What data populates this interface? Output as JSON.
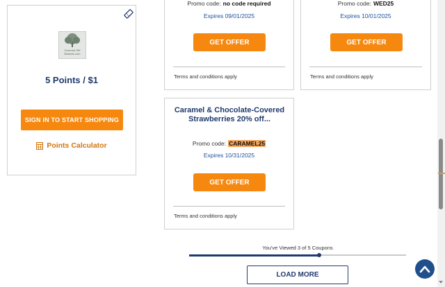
{
  "store": {
    "logo_text": "Gourmet Gift Baskets.com",
    "points_label": "5 Points / $1",
    "signin_label": "SIGN IN TO START SHOPPING",
    "calculator_label": "Points Calculator"
  },
  "coupons": [
    {
      "promo_label": "Promo code:",
      "code": "no code required",
      "expires": "Expires 09/01/2025",
      "button": "GET OFFER",
      "terms": "Terms and conditions apply"
    },
    {
      "promo_label": "Promo code:",
      "code": "WED25",
      "expires": "Expires 10/01/2025",
      "button": "GET OFFER",
      "terms": "Terms and conditions apply"
    },
    {
      "title_line1": "Caramel & Chocolate-Covered",
      "title_line2": "Strawberries 20% off...",
      "promo_label": "Promo code:",
      "code": "CARAMEL25",
      "expires": "Expires 10/31/2025",
      "button": "GET OFFER",
      "terms": "Terms and conditions apply"
    }
  ],
  "pagination": {
    "viewed_text": "You've Viewed 3 of 5 Coupons",
    "viewed_count": 3,
    "total_count": 5,
    "load_more_label": "LOAD MORE"
  },
  "colors": {
    "accent_orange": "#f6880f",
    "navy": "#1f3a6e",
    "link_blue": "#1f4f9c",
    "code_highlight": "#f2a35a"
  },
  "icons": {
    "tag": "tag-icon",
    "calculator": "calculator-icon",
    "scroll_top": "chevron-up-icon"
  }
}
